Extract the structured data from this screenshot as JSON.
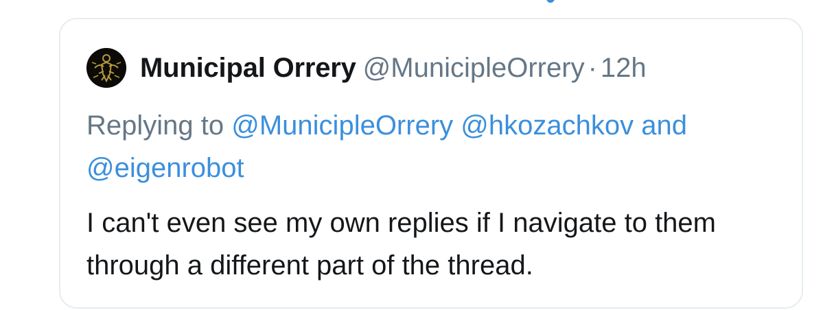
{
  "tweet": {
    "author": {
      "display_name": "Municipal Orrery",
      "handle": "@MunicipleOrrery"
    },
    "separator": "·",
    "timestamp": "12h",
    "reply_context": {
      "prefix": "Replying to",
      "mentions": [
        "@MunicipleOrrery",
        "@hkozachkov"
      ],
      "conjunction": "and",
      "final_mention": "@eigenrobot"
    },
    "body": "I can't even see my own replies if I navigate to them through a different part of the thread."
  },
  "colors": {
    "primary_text": "#14171a",
    "secondary_text": "#657786",
    "link": "#3b8fdc",
    "card_border": "#e6ecf0",
    "avatar_background": "#0c0b08",
    "avatar_gold": "#b89a3c"
  },
  "icons": {
    "avatar": "circular profile picture with gold figure"
  }
}
